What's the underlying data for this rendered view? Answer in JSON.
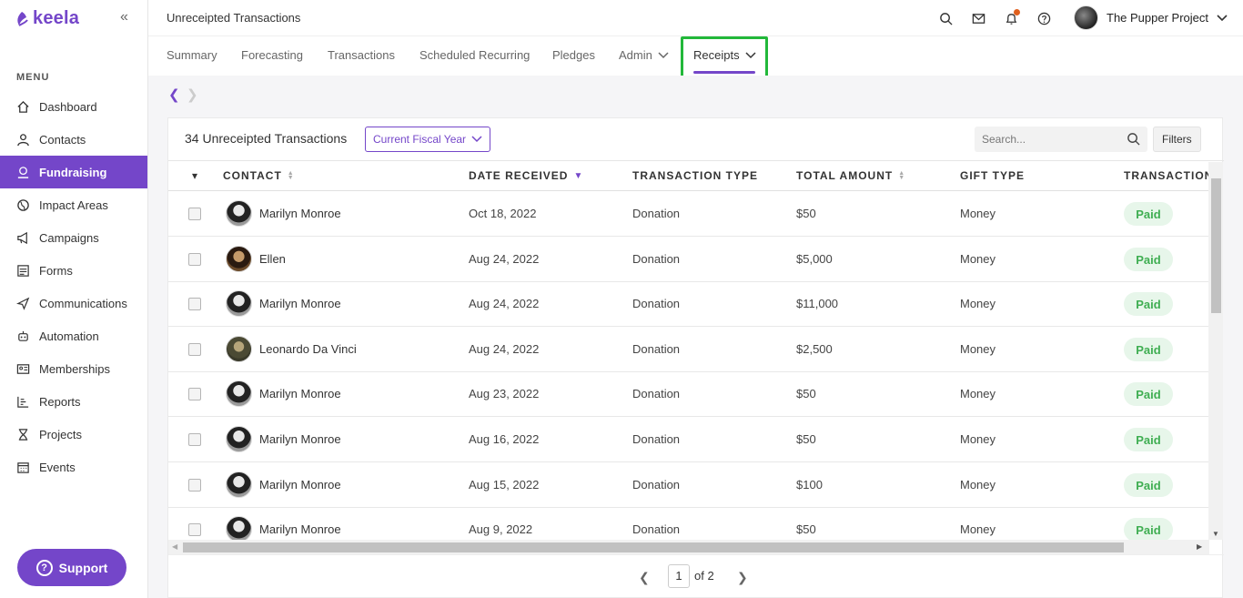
{
  "app": {
    "logo_text": "keela"
  },
  "sidebar": {
    "menu_label": "MENU",
    "items": [
      {
        "label": "Dashboard",
        "icon": "home-icon"
      },
      {
        "label": "Contacts",
        "icon": "person-icon"
      },
      {
        "label": "Fundraising",
        "icon": "donation-icon",
        "active": true
      },
      {
        "label": "Impact Areas",
        "icon": "globe-icon"
      },
      {
        "label": "Campaigns",
        "icon": "megaphone-icon"
      },
      {
        "label": "Forms",
        "icon": "form-icon"
      },
      {
        "label": "Communications",
        "icon": "send-icon"
      },
      {
        "label": "Automation",
        "icon": "robot-icon"
      },
      {
        "label": "Memberships",
        "icon": "id-card-icon"
      },
      {
        "label": "Reports",
        "icon": "reports-icon"
      },
      {
        "label": "Projects",
        "icon": "hourglass-icon"
      },
      {
        "label": "Events",
        "icon": "calendar-icon"
      }
    ],
    "support_label": "Support"
  },
  "header": {
    "title": "Unreceipted Transactions",
    "org_name": "The Pupper Project"
  },
  "tabs": [
    {
      "label": "Summary"
    },
    {
      "label": "Forecasting"
    },
    {
      "label": "Transactions"
    },
    {
      "label": "Scheduled Recurring"
    },
    {
      "label": "Pledges"
    },
    {
      "label": "Admin"
    },
    {
      "label": "Receipts",
      "active": true
    }
  ],
  "card": {
    "count_title": "34 Unreceipted Transactions",
    "period": "Current Fiscal Year",
    "search_placeholder": "Search...",
    "filters_label": "Filters"
  },
  "table": {
    "columns": [
      "CONTACT",
      "DATE RECEIVED",
      "TRANSACTION TYPE",
      "TOTAL AMOUNT",
      "GIFT TYPE",
      "TRANSACTION"
    ],
    "rows": [
      {
        "contact": "Marilyn Monroe",
        "date": "Oct 18, 2022",
        "type": "Donation",
        "amount": "$50",
        "gift": "Money",
        "status": "Paid"
      },
      {
        "contact": "Ellen",
        "date": "Aug 24, 2022",
        "type": "Donation",
        "amount": "$5,000",
        "gift": "Money",
        "status": "Paid"
      },
      {
        "contact": "Marilyn Monroe",
        "date": "Aug 24, 2022",
        "type": "Donation",
        "amount": "$11,000",
        "gift": "Money",
        "status": "Paid"
      },
      {
        "contact": "Leonardo Da Vinci",
        "date": "Aug 24, 2022",
        "type": "Donation",
        "amount": "$2,500",
        "gift": "Money",
        "status": "Paid"
      },
      {
        "contact": "Marilyn Monroe",
        "date": "Aug 23, 2022",
        "type": "Donation",
        "amount": "$50",
        "gift": "Money",
        "status": "Paid"
      },
      {
        "contact": "Marilyn Monroe",
        "date": "Aug 16, 2022",
        "type": "Donation",
        "amount": "$50",
        "gift": "Money",
        "status": "Paid"
      },
      {
        "contact": "Marilyn Monroe",
        "date": "Aug 15, 2022",
        "type": "Donation",
        "amount": "$100",
        "gift": "Money",
        "status": "Paid"
      },
      {
        "contact": "Marilyn Monroe",
        "date": "Aug 9, 2022",
        "type": "Donation",
        "amount": "$50",
        "gift": "Money",
        "status": "Paid"
      }
    ]
  },
  "pager": {
    "current": "1",
    "of_label": "of 2"
  },
  "colors": {
    "brand": "#7446c9",
    "paid_bg": "#e7f6ea",
    "paid_text": "#3fae52",
    "highlight": "#22b83a"
  }
}
